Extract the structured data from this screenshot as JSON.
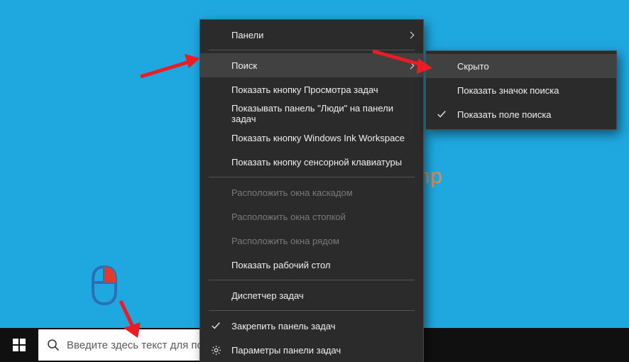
{
  "watermark": "Comp",
  "taskbar": {
    "search_placeholder": "Введите здесь текст для поиска"
  },
  "context_menu": {
    "panels": "Панели",
    "search": "Поиск",
    "show_taskview": "Показать кнопку Просмотра задач",
    "show_people": "Показывать панель \"Люди\" на панели задач",
    "show_ink": "Показать кнопку Windows Ink Workspace",
    "show_touchkb": "Показать кнопку сенсорной клавиатуры",
    "cascade": "Расположить окна каскадом",
    "stacked": "Расположить окна стопкой",
    "side": "Расположить окна рядом",
    "show_desktop": "Показать рабочий стол",
    "task_manager": "Диспетчер задач",
    "lock_taskbar": "Закрепить панель задач",
    "taskbar_settings": "Параметры панели задач"
  },
  "submenu": {
    "hidden": "Скрыто",
    "show_icon": "Показать значок поиска",
    "show_field": "Показать поле поиска"
  }
}
